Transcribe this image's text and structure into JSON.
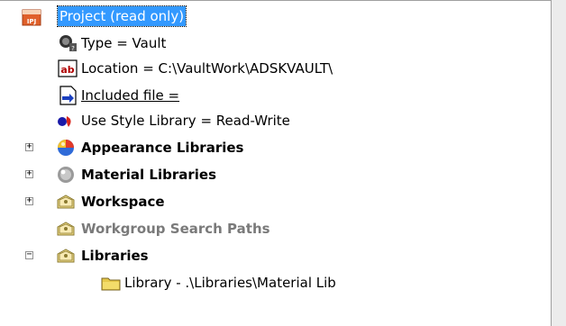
{
  "tree": {
    "root": {
      "label": "Project (read only)",
      "icon": "ipj-project-icon",
      "badge": "IPJ"
    },
    "properties": [
      {
        "label": "Type = Vault",
        "icon": "vault-type-icon"
      },
      {
        "label": "Location = C:\\VaultWork\\ADSKVAULT\\",
        "icon": "text-field-icon",
        "badge": "ab"
      },
      {
        "label": "Included file = ",
        "icon": "included-file-icon"
      },
      {
        "label": "Use Style Library = Read-Write",
        "icon": "style-library-icon"
      }
    ],
    "groups": [
      {
        "label": "Appearance Libraries",
        "icon": "appearance-sphere-icon",
        "expander": "+"
      },
      {
        "label": "Material Libraries",
        "icon": "material-sphere-icon",
        "expander": "+"
      },
      {
        "label": "Workspace",
        "icon": "workspace-icon",
        "expander": "+"
      },
      {
        "label": "Workgroup Search Paths",
        "icon": "workgroup-icon"
      },
      {
        "label": "Libraries",
        "icon": "libraries-icon",
        "expander": "−"
      }
    ],
    "children": [
      {
        "label": "Library - .\\Libraries\\Material Lib",
        "icon": "folder-icon"
      }
    ]
  },
  "colors": {
    "selection": "#3399ff",
    "disabled_text": "#7a7a7a"
  }
}
